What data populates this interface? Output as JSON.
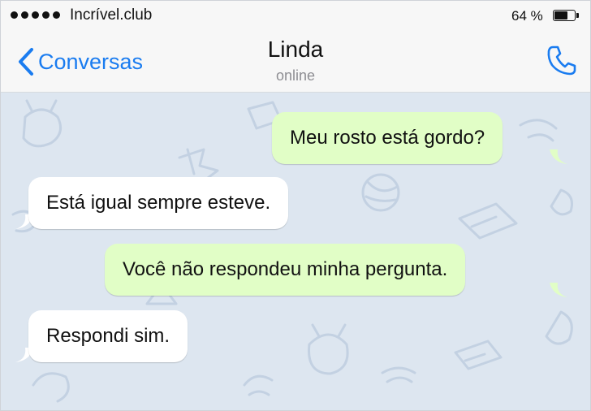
{
  "status_bar": {
    "carrier": "Incrível.club",
    "battery": "64 %",
    "battery_level": 0.64
  },
  "header": {
    "back_label": "Conversas",
    "contact_name": "Linda",
    "contact_status": "online",
    "back_icon": "chevron-left-icon",
    "call_icon": "phone-icon"
  },
  "messages": [
    {
      "direction": "outgoing",
      "text": "Meu rosto está gordo?"
    },
    {
      "direction": "incoming",
      "text": "Está igual sempre esteve."
    },
    {
      "direction": "outgoing",
      "text": "Você não respondeu minha pergunta."
    },
    {
      "direction": "incoming",
      "text": "Respondi sim."
    }
  ],
  "colors": {
    "accent": "#1a7cf0",
    "outgoing_bubble": "#e1fec6",
    "incoming_bubble": "#ffffff",
    "chat_background": "#dde6f0"
  }
}
